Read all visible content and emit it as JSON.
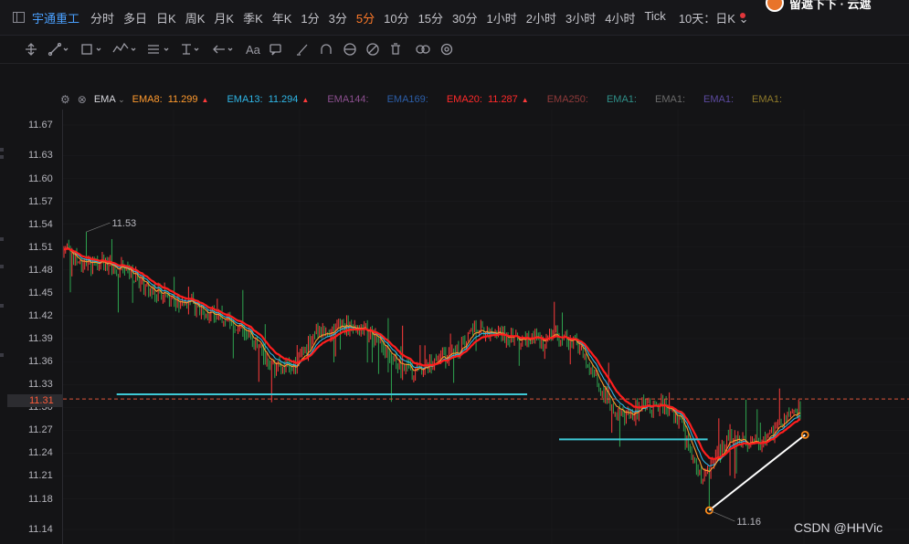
{
  "header": {
    "symbol": "宇通重工",
    "periods": [
      "分时",
      "多日",
      "日K",
      "周K",
      "月K",
      "季K",
      "年K",
      "1分",
      "3分",
      "5分",
      "10分",
      "15分",
      "30分",
      "1小时",
      "2小时",
      "3小时",
      "4小时",
      "Tick"
    ],
    "active_period": "5分",
    "multi_label": "10天：日K",
    "profile_name": "留遮下下 · 云遮"
  },
  "toolbar": {
    "tools": [
      "move-icon",
      "line-icon",
      "rect-icon",
      "pattern-icon",
      "fib-icon",
      "measure-icon",
      "arrow-icon",
      "text-icon",
      "note-icon",
      "pen-icon",
      "magnet-icon",
      "sync-icon",
      "hide-icon",
      "delete-icon",
      "link-icon",
      "settings-icon"
    ]
  },
  "legend": {
    "name": "EMA",
    "items": [
      {
        "label": "EMA8:",
        "value": "11.299",
        "color": "#ff9a2e",
        "arrow": true
      },
      {
        "label": "EMA13:",
        "value": "11.294",
        "color": "#2fb6e6",
        "arrow": true
      },
      {
        "label": "EMA144:",
        "value": "",
        "color": "#8c4f8f",
        "arrow": false
      },
      {
        "label": "EMA169:",
        "value": "",
        "color": "#2c5ea8",
        "arrow": false
      },
      {
        "label": "EMA20:",
        "value": "11.287",
        "color": "#ff2a2a",
        "arrow": true
      },
      {
        "label": "EMA250:",
        "value": "",
        "color": "#8f3a3a",
        "arrow": false
      },
      {
        "label": "EMA1:",
        "value": "",
        "color": "#2f8f88",
        "arrow": false
      },
      {
        "label": "EMA1:",
        "value": "",
        "color": "#6a6a6a",
        "arrow": false
      },
      {
        "label": "EMA1:",
        "value": "",
        "color": "#5c4aa0",
        "arrow": false
      },
      {
        "label": "EMA1:",
        "value": "",
        "color": "#8f7a2a",
        "arrow": false
      }
    ]
  },
  "chart_data": {
    "type": "candlestick",
    "yaxis": {
      "ticks": [
        11.67,
        11.63,
        11.6,
        11.57,
        11.54,
        11.51,
        11.48,
        11.45,
        11.42,
        11.39,
        11.36,
        11.33,
        11.3,
        11.27,
        11.24,
        11.21,
        11.18,
        11.14
      ],
      "range": [
        11.13,
        11.69
      ]
    },
    "current_price": "11.31",
    "current_price_value": 11.311,
    "annotations": [
      {
        "text": "11.53",
        "price": 11.53,
        "bar_index": 14
      },
      {
        "text": "11.16",
        "price": 11.165,
        "bar_index": 404
      }
    ],
    "bar_count": 462,
    "close_profile": [
      {
        "i": 0,
        "p": 11.505
      },
      {
        "i": 10,
        "p": 11.49
      },
      {
        "i": 25,
        "p": 11.49
      },
      {
        "i": 40,
        "p": 11.48
      },
      {
        "i": 55,
        "p": 11.455
      },
      {
        "i": 70,
        "p": 11.44
      },
      {
        "i": 85,
        "p": 11.43
      },
      {
        "i": 100,
        "p": 11.415
      },
      {
        "i": 115,
        "p": 11.395
      },
      {
        "i": 130,
        "p": 11.355
      },
      {
        "i": 145,
        "p": 11.355
      },
      {
        "i": 160,
        "p": 11.4
      },
      {
        "i": 175,
        "p": 11.41
      },
      {
        "i": 190,
        "p": 11.395
      },
      {
        "i": 200,
        "p": 11.38
      },
      {
        "i": 210,
        "p": 11.355
      },
      {
        "i": 220,
        "p": 11.345
      },
      {
        "i": 230,
        "p": 11.36
      },
      {
        "i": 245,
        "p": 11.37
      },
      {
        "i": 258,
        "p": 11.405
      },
      {
        "i": 268,
        "p": 11.395
      },
      {
        "i": 280,
        "p": 11.39
      },
      {
        "i": 300,
        "p": 11.39
      },
      {
        "i": 310,
        "p": 11.395
      },
      {
        "i": 320,
        "p": 11.385
      },
      {
        "i": 330,
        "p": 11.345
      },
      {
        "i": 340,
        "p": 11.31
      },
      {
        "i": 350,
        "p": 11.285
      },
      {
        "i": 362,
        "p": 11.3
      },
      {
        "i": 373,
        "p": 11.305
      },
      {
        "i": 385,
        "p": 11.285
      },
      {
        "i": 393,
        "p": 11.235
      },
      {
        "i": 400,
        "p": 11.205
      },
      {
        "i": 410,
        "p": 11.24
      },
      {
        "i": 418,
        "p": 11.265
      },
      {
        "i": 428,
        "p": 11.255
      },
      {
        "i": 438,
        "p": 11.25
      },
      {
        "i": 448,
        "p": 11.275
      },
      {
        "i": 455,
        "p": 11.29
      },
      {
        "i": 462,
        "p": 11.3
      }
    ],
    "drawings": [
      {
        "type": "horizontal",
        "price": 11.317,
        "from_bar": 33,
        "to_bar": 290,
        "color": "#3ec9d6"
      },
      {
        "type": "horizontal",
        "price": 11.258,
        "from_bar": 310,
        "to_bar": 403,
        "color": "#3ec9d6"
      },
      {
        "type": "trendline",
        "from": {
          "bar": 404,
          "price": 11.165
        },
        "to": {
          "bar": 464,
          "price": 11.264
        },
        "color": "#ffffff"
      }
    ],
    "colors": {
      "up": "#ff3b3b",
      "down": "#2ea44f",
      "ema8": "#ff9a2e",
      "ema13": "#2fb6e6",
      "ema20": "#ff1e1e",
      "price_line": "#d9543a",
      "grid": "#2a2a2f"
    }
  },
  "watermark": "CSDN @HHVic"
}
